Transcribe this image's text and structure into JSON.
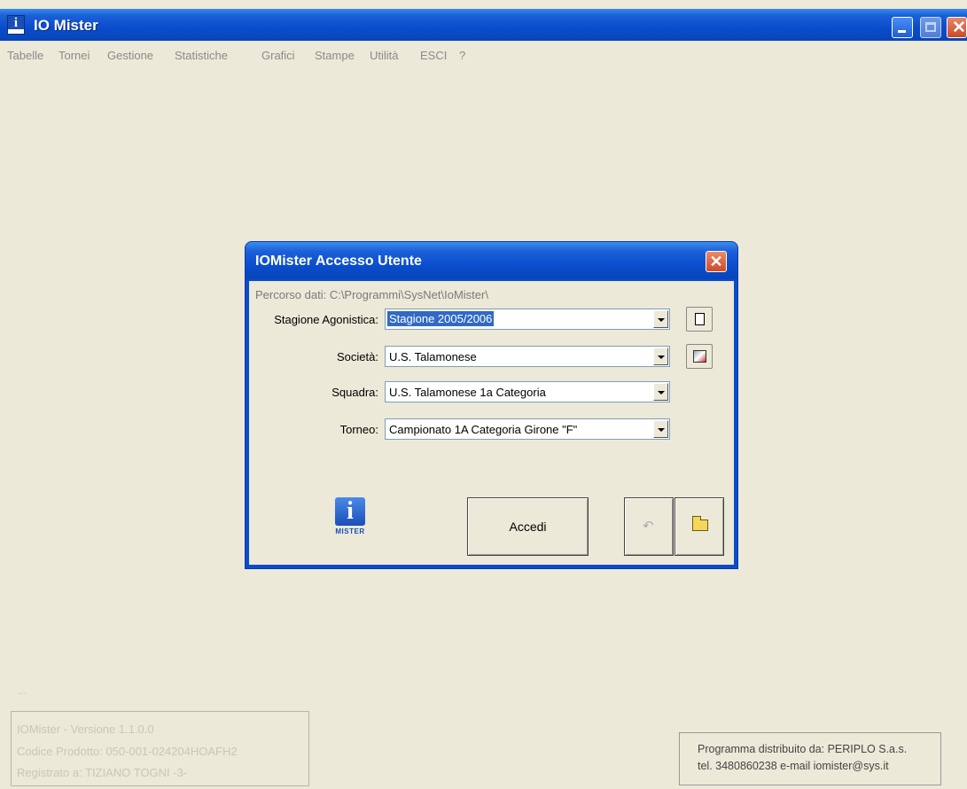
{
  "window": {
    "title": "IO Mister",
    "icon_letter": "i"
  },
  "menu": [
    "Tabelle",
    "Tornei",
    "Gestione",
    "Statistiche",
    "Grafici",
    "Stampe",
    "Utilità",
    "ESCI",
    "?"
  ],
  "dialog": {
    "title": "IOMister Accesso Utente",
    "close_symbol": "✕",
    "path_text": "Percorso dati: C:\\Programmi\\SysNet\\IoMister\\",
    "fields": {
      "stagione": {
        "label": "Stagione Agonistica:",
        "value": "Stagione 2005/2006"
      },
      "societa": {
        "label": "Società:",
        "value": "U.S. Talamonese"
      },
      "squadra": {
        "label": "Squadra:",
        "value": "U.S. Talamonese 1a Categoria"
      },
      "torneo": {
        "label": "Torneo:",
        "value": "Campionato 1A Categoria Girone \"F\""
      }
    },
    "logo_letter": "i",
    "logo_text": "MISTER",
    "accedi_label": "Accedi"
  },
  "footer": {
    "dots": "...",
    "version": "IOMister - Versione 1.1.0.0",
    "product_code": "Codice Prodotto: 050-001-024204HOAFH2",
    "registered": "Registrato a: TIZIANO TOGNI -3-",
    "distributor": "Programma distribuito da: PERIPLO S.a.s.",
    "contact": "tel. 3480860238 e-mail iomister@sys.it"
  }
}
